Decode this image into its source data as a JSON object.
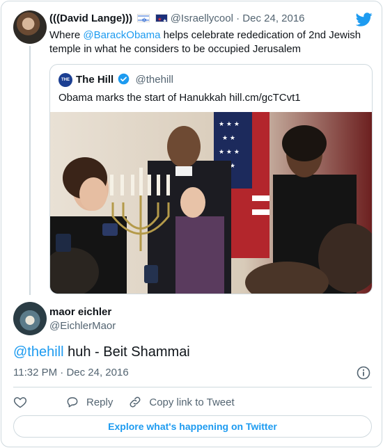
{
  "parent_tweet": {
    "name": "(((David Lange)))",
    "handle": "@Israellycool",
    "separator": "·",
    "date": "Dec 24, 2016",
    "text_prefix": "Where ",
    "mention": "@BarackObama",
    "text_suffix": " helps celebrate rededication of 2nd Jewish temple in what he considers to be occupied Jerusalem",
    "flags": [
      "israel-flag-icon",
      "australia-flag-icon"
    ]
  },
  "quoted_tweet": {
    "avatar_text": "THE HILL",
    "name": "The Hill",
    "handle": "@thehill",
    "text": "Obama marks the start of Hanukkah hill.cm/gcTCvt1"
  },
  "reply": {
    "name": "maor eichler",
    "handle": "@EichlerMaor",
    "mention": "@thehill",
    "text": " huh - Beit Shammai",
    "time": "11:32 PM",
    "separator": "·",
    "date": "Dec 24, 2016"
  },
  "actions": {
    "like_icon": "heart-icon",
    "reply_label": "Reply",
    "copy_label": "Copy link to Tweet"
  },
  "footer": {
    "explore_label": "Explore what's happening on Twitter"
  },
  "colors": {
    "accent": "#1d9bf0",
    "secondary_text": "#536471",
    "border": "#cfd9de"
  }
}
